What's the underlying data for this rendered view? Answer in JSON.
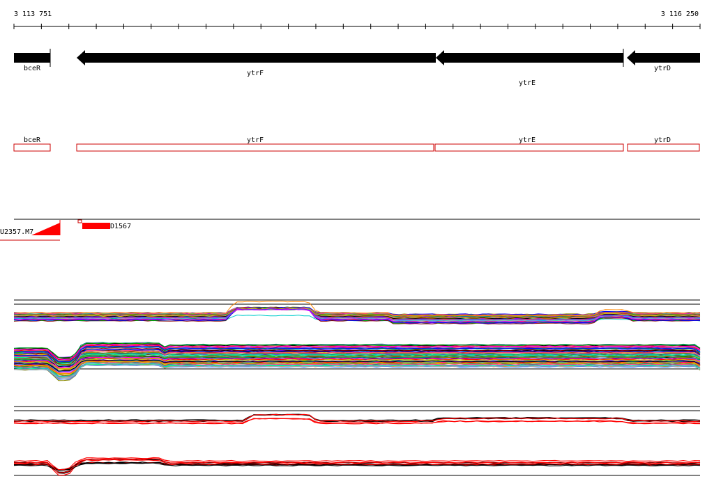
{
  "coordinate_start": "3 113 751",
  "coordinate_end": "3 116 250",
  "genes": [
    {
      "name": "bceR",
      "strand": "-"
    },
    {
      "name": "ytrF",
      "strand": "-"
    },
    {
      "name": "ytrE",
      "strand": "-"
    },
    {
      "name": "ytrD",
      "strand": "-"
    }
  ],
  "cds": [
    {
      "name": "bceR"
    },
    {
      "name": "ytrF"
    },
    {
      "name": "ytrE"
    },
    {
      "name": "ytrD"
    }
  ],
  "features": [
    {
      "name": "U2357.M7"
    },
    {
      "name": "D1567"
    }
  ],
  "colors": {
    "gene_arrow": "#000000",
    "cds_outline": "#cc0000",
    "feature_fill": "#ff0000",
    "axis": "#000000"
  },
  "track_palette": [
    "#ff0000",
    "#00aa00",
    "#0000ff",
    "#ff00ff",
    "#00cccc",
    "#cccc00",
    "#ff8800",
    "#8800ff",
    "#008888",
    "#880000",
    "#00ff88",
    "#888800",
    "#4488ff",
    "#ff4488",
    "#000000",
    "#aaaaaa"
  ]
}
